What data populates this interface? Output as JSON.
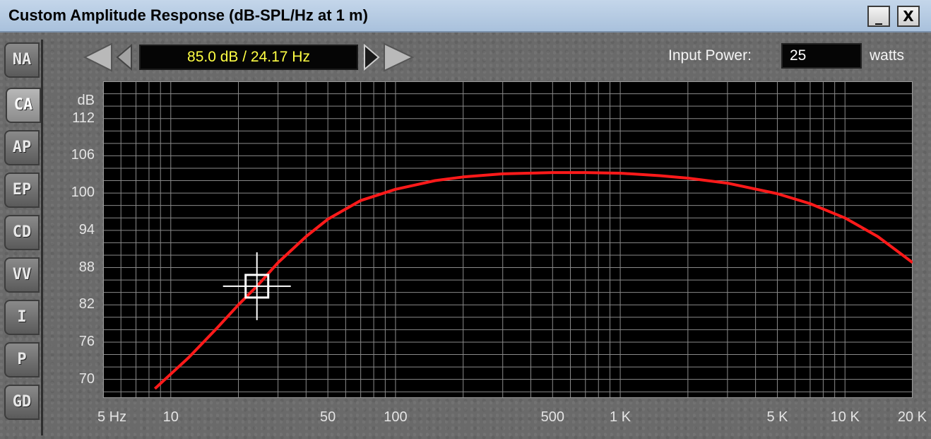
{
  "window": {
    "title": "Custom Amplitude Response (dB-SPL/Hz at 1 m)",
    "minimize_label": "_",
    "close_label": "X"
  },
  "tabs": [
    {
      "label": "NA",
      "active": false
    },
    {
      "label": "CA",
      "active": true
    },
    {
      "label": "AP",
      "active": false
    },
    {
      "label": "EP",
      "active": false
    },
    {
      "label": "CD",
      "active": false
    },
    {
      "label": "VV",
      "active": false
    },
    {
      "label": "I",
      "active": false
    },
    {
      "label": "P",
      "active": false
    },
    {
      "label": "GD",
      "active": false
    }
  ],
  "toolbar": {
    "readout": "85.0 dB / 24.17 Hz",
    "input_power_label": "Input Power:",
    "input_power_value": "25",
    "input_power_unit": "watts"
  },
  "chart_data": {
    "type": "line",
    "ylabel": "dB",
    "x_scale": "log",
    "xlim": [
      5,
      20000
    ],
    "ylim": [
      67,
      118
    ],
    "y_ticks": [
      {
        "value": 112,
        "label": "112"
      },
      {
        "value": 106,
        "label": "106"
      },
      {
        "value": 100,
        "label": "100"
      },
      {
        "value": 94,
        "label": "94"
      },
      {
        "value": 88,
        "label": "88"
      },
      {
        "value": 82,
        "label": "82"
      },
      {
        "value": 76,
        "label": "76"
      },
      {
        "value": 70,
        "label": "70"
      }
    ],
    "x_ticks": [
      {
        "value": 5,
        "label": "5 Hz"
      },
      {
        "value": 10,
        "label": "10"
      },
      {
        "value": 50,
        "label": "50"
      },
      {
        "value": 100,
        "label": "100"
      },
      {
        "value": 500,
        "label": "500"
      },
      {
        "value": 1000,
        "label": "1 K"
      },
      {
        "value": 5000,
        "label": "5 K"
      },
      {
        "value": 10000,
        "label": "10 K"
      },
      {
        "value": 20000,
        "label": "20 K"
      }
    ],
    "grid": true,
    "series": [
      {
        "color": "#ff1a1a",
        "x": [
          8.5,
          12,
          16,
          20,
          24.17,
          30,
          40,
          50,
          70,
          100,
          150,
          200,
          300,
          500,
          700,
          1000,
          1500,
          2000,
          3000,
          5000,
          7000,
          10000,
          14000,
          20000
        ],
        "y": [
          68.5,
          73.5,
          78.2,
          82.0,
          85.0,
          88.8,
          93.0,
          95.8,
          98.8,
          100.6,
          102.0,
          102.6,
          103.1,
          103.3,
          103.3,
          103.2,
          102.8,
          102.4,
          101.6,
          99.9,
          98.3,
          96.0,
          93.0,
          88.8
        ]
      }
    ],
    "cursor": {
      "x": 24.17,
      "y": 85.0
    }
  }
}
